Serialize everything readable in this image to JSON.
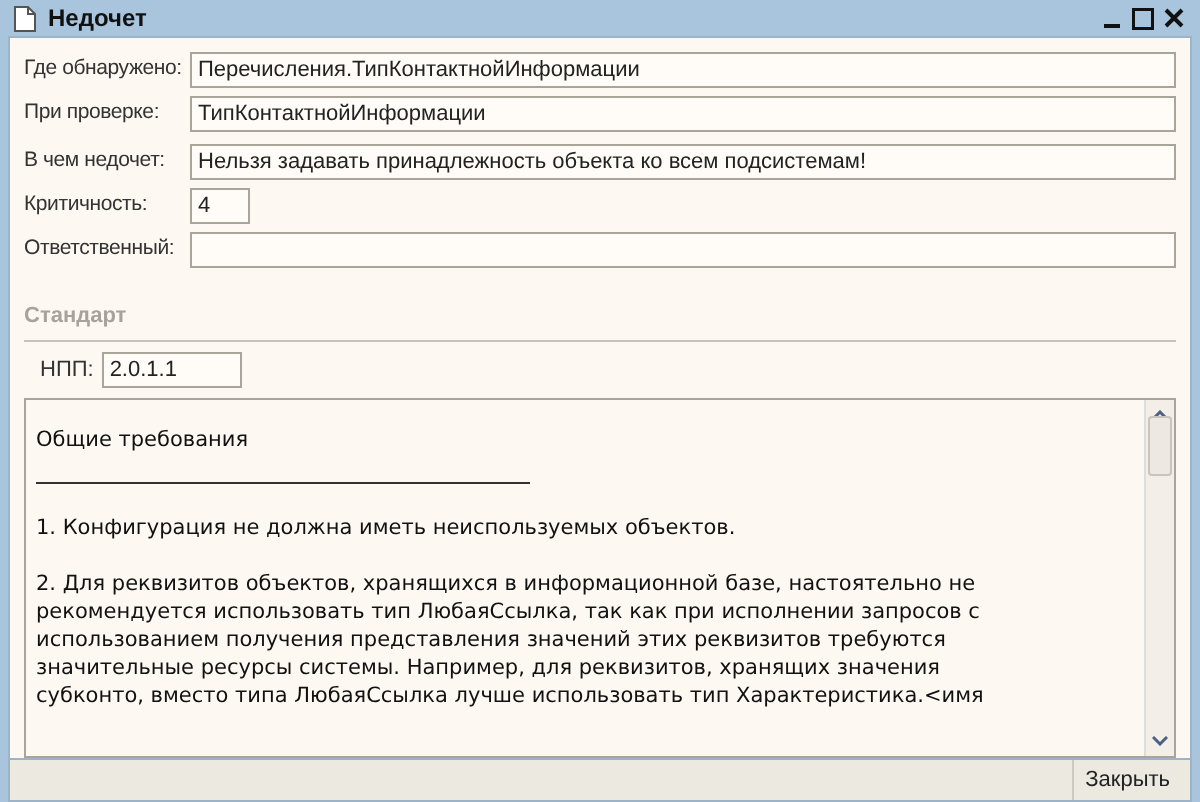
{
  "window": {
    "title": "Недочет"
  },
  "fields": [
    {
      "label": "Где обнаружено:",
      "value": "Перечисления.ТипКонтактнойИнформации",
      "kind": "wide"
    },
    {
      "label": "При проверке:",
      "value": "ТипКонтактнойИнформации",
      "kind": "wide"
    },
    {
      "label": "В чем недочет:",
      "value": "Нельзя задавать принадлежность объекта ко всем подсистемам!",
      "kind": "wide"
    },
    {
      "label": "Критичность:",
      "value": "4",
      "kind": "short"
    },
    {
      "label": "Ответственный:",
      "kind": "wide"
    }
  ],
  "standard": {
    "title": "Стандарт",
    "npp_label": "НПП:",
    "npp_value": "2.0.1.1",
    "document": [
      {
        "kind": "heading",
        "lines": [
          "Общие требования"
        ]
      },
      {
        "kind": "rule"
      },
      {
        "kind": "paragraph",
        "lines": [
          "1. Конфигурация не должна иметь неиспользуемых объектов."
        ]
      },
      {
        "kind": "paragraph",
        "lines": [
          "2. Для реквизитов объектов, хранящихся в информационной базе, настоятельно не",
          "рекомендуется использовать тип ЛюбаяСсылка, так как при исполнении запросов с",
          "использованием получения представления значений этих реквизитов требуются",
          "значительные ресурсы системы. Например, для реквизитов, хранящих значения",
          "субконто, вместо типа ЛюбаяСсылка лучше использовать тип Характеристика.<имя"
        ]
      }
    ]
  },
  "buttons": [
    "Закрыть"
  ]
}
